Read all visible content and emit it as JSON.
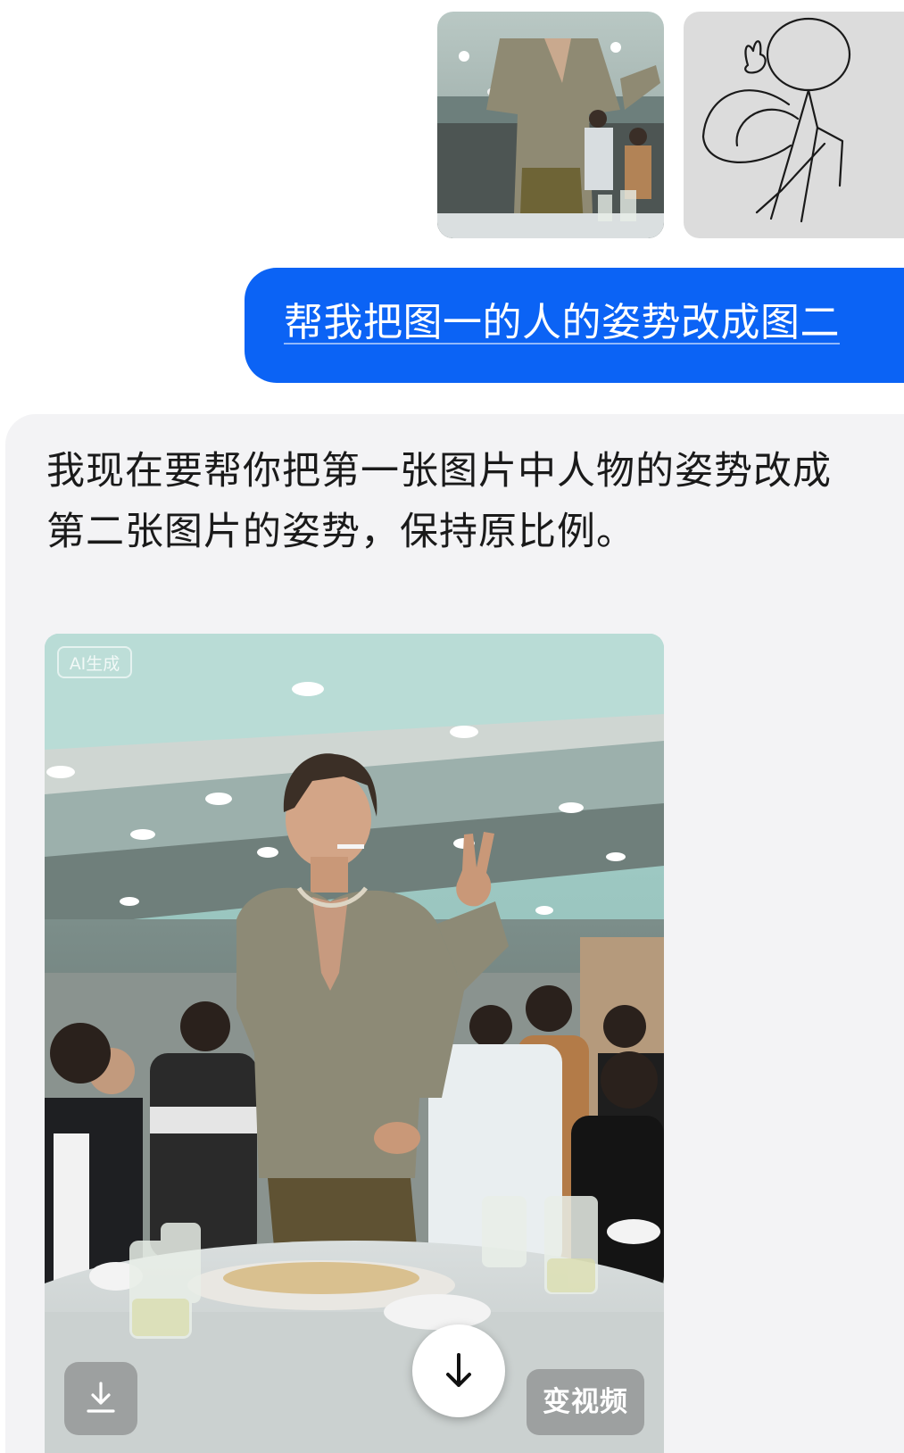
{
  "chat": {
    "attachments": [
      {
        "name": "photo-reference"
      },
      {
        "name": "sketch-pose"
      }
    ],
    "user_message": "帮我把图一的人的姿势改成图二",
    "assistant_message": "我现在要帮你把第一张图片中人物的姿势改成第二张图片的姿势，保持原比例。",
    "generated_image": {
      "badge": "AI生成",
      "video_button": "变视频"
    }
  },
  "icons": {
    "save": "download-tray-icon",
    "download": "arrow-down-icon"
  },
  "colors": {
    "user_bubble": "#0b63f5",
    "assistant_card": "#f3f3f5"
  }
}
